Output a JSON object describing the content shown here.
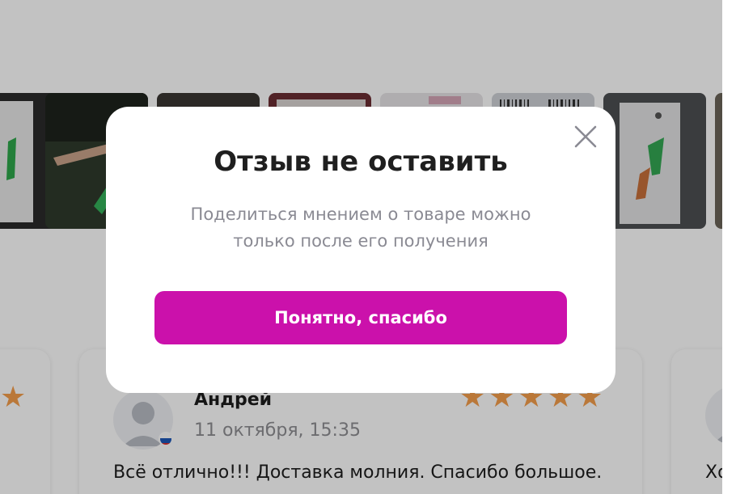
{
  "modal": {
    "title": "Отзыв не оставить",
    "message_line1": "Поделиться мнением о товаре можно",
    "message_line2": "только после его получения",
    "confirm_label": "Понятно, спасибо",
    "close_icon": "close-icon"
  },
  "reviews": [
    {
      "author": "Андрей",
      "date": "11 октября, 15:35",
      "text": "Всё отлично!!! Доставка молния. Спасибо большое.",
      "rating": 5,
      "country_flag": "ru-flag-icon"
    },
    {
      "text_fragment": "Хо"
    }
  ],
  "photos": {
    "count_visible": 7
  },
  "colors": {
    "accent": "#cb11ab",
    "star": "#f59e4c",
    "overlay": "rgba(0,0,0,0.24)"
  }
}
